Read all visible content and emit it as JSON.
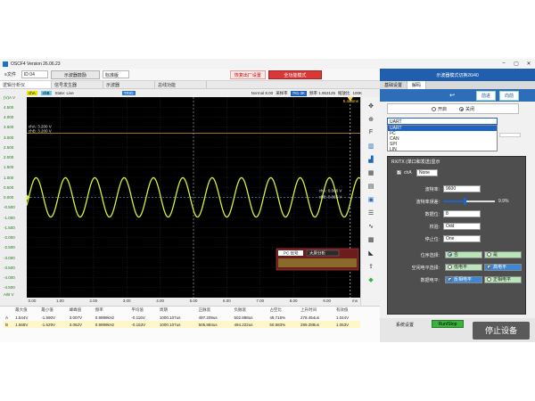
{
  "window": {
    "title": "OSCF4  Version 26.06.23",
    "controls": [
      "–",
      "▢",
      "✕"
    ]
  },
  "toolbar": {
    "file_menu": "≡文件",
    "device_select": "ID 04",
    "scope_button": "示波器鼓励",
    "standard_select": "标准版",
    "restore_button": "恢复出厂设置",
    "quick_mode_button": "全功能模式"
  },
  "right_header": {
    "title": "示波器模式切换26/40"
  },
  "tabs": [
    {
      "label": "逻辑分析仪",
      "active": true
    },
    {
      "label": "信号发生器",
      "active": false
    },
    {
      "label": "示波器",
      "active": false
    },
    {
      "label": "总线功能",
      "active": false
    }
  ],
  "scope_status": {
    "chA": "chA",
    "chB": "chB",
    "state": "State: Live",
    "trigger_box": "TRIG",
    "mode": "Normal  8.00",
    "sample_label": "采样率",
    "sample_value": "781.3K",
    "freq": "频率 1.953125",
    "zoom_label": "缩放比",
    "zoom_value": "100K"
  },
  "plot": {
    "cursor_a_label": "chA: 3.200 V",
    "cursor_b_label": "chB: 3.200 V",
    "right_a_label": "chA: 0.066 V",
    "right_b_label": "chB: 0.065 V",
    "corner_label": "5.446ms",
    "pc_label": "PC 信号",
    "pc_dropdown": "大屏分析",
    "y_top_label": "(V)A V",
    "y_bottom_label": "A/B V",
    "x_unit_label": "ms"
  },
  "chart_data": {
    "type": "line",
    "x": [
      0.0,
      0.5,
      1.0,
      1.5,
      2.0,
      2.5,
      3.0,
      3.5,
      4.0,
      4.5,
      5.0,
      5.5,
      6.0,
      6.5,
      7.0,
      7.5,
      8.0,
      8.5,
      9.0,
      9.5,
      10.0
    ],
    "series": [
      {
        "name": "chA",
        "values": [
          0.0,
          0.98,
          0.0,
          -0.98,
          0.0,
          0.98,
          0.0,
          -0.98,
          0.0,
          0.98,
          0.0,
          -0.98,
          0.0,
          0.98,
          0.0,
          -0.98,
          0.0,
          0.98,
          0.0,
          -0.98,
          0.0
        ]
      }
    ],
    "period_ms": 0.88,
    "xlim": [
      0,
      10
    ],
    "ylim": [
      -5,
      5
    ],
    "x_ticks": [
      "0.00",
      "1.00",
      "2.00",
      "3.00",
      "4.00",
      "5.00",
      "6.00",
      "7.00",
      "8.00",
      "9.00",
      "ms"
    ],
    "y_ticks": [
      "5.000",
      "4.500",
      "4.000",
      "3.500",
      "3.000",
      "2.500",
      "2.000",
      "1.500",
      "1.000",
      "0.500",
      "0.000",
      "-0.500",
      "-1.000",
      "-1.500",
      "-2.000",
      "-2.500",
      "-3.000",
      "-3.500",
      "-4.000",
      "-4.500",
      "-5.000"
    ],
    "grid": true,
    "colors": {
      "signal": "#d8f03a",
      "grid": "#2b2b2b",
      "cursor": "#d89a2a",
      "trigger": "#ffd23a"
    }
  },
  "iconbar": {
    "icons": [
      "cross-arrows-icon",
      "zoom-in-icon",
      "font-icon",
      "bars-icon",
      "stats-icon",
      "calc-icon",
      "ruler-icon",
      "save-icon",
      "list-icon",
      "wave-icon",
      "grid-icon",
      "triangle-icon",
      "export-icon",
      "tag-icon"
    ]
  },
  "measurements": {
    "headers": [
      "",
      "最大值",
      "最小值",
      "峰峰值",
      "频率",
      "平均值",
      "周期",
      "正脉宽",
      "负脉宽",
      "占空比",
      "上升时间",
      "有效值"
    ],
    "rows": [
      [
        "A",
        "1.544V",
        "-1.590V",
        "3.007V",
        "0.9999kHz",
        "-0.116V",
        "1000.107us",
        "497.209us",
        "502.898us",
        "49.716%",
        "278.454us",
        "1.044V"
      ],
      [
        "B",
        "1.568V",
        "-1.629V",
        "3.062V",
        "0.9999kHz",
        "-0.153V",
        "1000.107us",
        "505.884us",
        "494.222us",
        "50.583%",
        "289.288us",
        "1.053V"
      ]
    ]
  },
  "panel": {
    "tabs": [
      {
        "label": "基础设置",
        "active": false
      },
      {
        "label": "解码",
        "active": true
      }
    ],
    "nav_back": "↩",
    "nav_prev": "前进",
    "nav_next": "向前",
    "mode_on": "开启",
    "mode_off": "关闭",
    "protocol_selected": "UART",
    "protocol_options": [
      "UART",
      "I²C",
      "CAN",
      "SPI",
      "LIN"
    ],
    "uart_title": "RX/TX (单口和发送)显示",
    "channel_label": "chA",
    "channel_value": "None",
    "baud_label": "波特率:",
    "baud_value": "9600",
    "threshold_label": "波特率误差:",
    "threshold_percent": "9.9%",
    "data_bits_label": "数据位:",
    "data_bits_value": "8",
    "parity_label": "校验:",
    "parity_value": "Odd",
    "stop_label": "停止位:",
    "stop_value": "One",
    "bit_order_label": "位序选择:",
    "bit_order_off": "否",
    "bit_order_on": "是",
    "idle_label": "空闲电平选择:",
    "idle_off": "低电平",
    "idle_on": "高电平",
    "polarity_label": "数据电平:",
    "polarity_off": "反相电平",
    "polarity_on": "正相电平",
    "footer_system": "系统设置",
    "footer_run": "Run/Stop",
    "footer_stop": "停止设备"
  }
}
